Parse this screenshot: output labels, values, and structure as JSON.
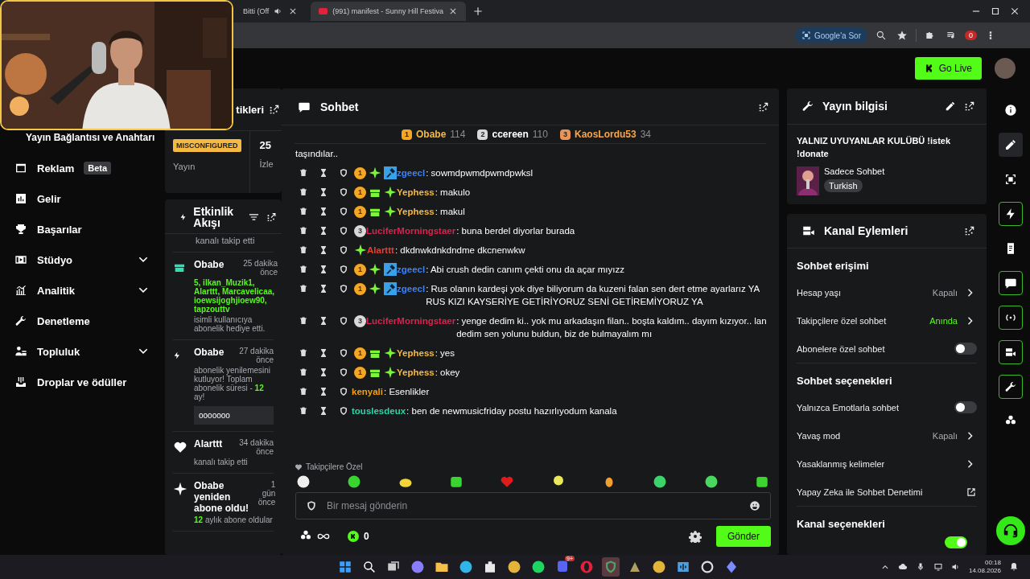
{
  "browser": {
    "tabs": [
      {
        "title": "Bitti (Off",
        "selected": false,
        "audio": true
      },
      {
        "title": "(991) manifest - Sunny Hill Festiva",
        "selected": true,
        "audio": false
      }
    ],
    "ask_google": "Google'a Sor",
    "extension_badge": "0"
  },
  "header": {
    "go_live": "Go Live"
  },
  "nav": [
    {
      "label": "Yayın Bağlantısı ve Anahtarı",
      "kind": "plain"
    },
    {
      "label": "Reklam",
      "kind": "ad",
      "badge": "Beta",
      "expandable": false
    },
    {
      "label": "Gelir",
      "kind": "revenue",
      "expandable": false
    },
    {
      "label": "Başarılar",
      "kind": "trophy",
      "expandable": false
    },
    {
      "label": "Stüdyo",
      "kind": "studio",
      "expandable": true
    },
    {
      "label": "Analitik",
      "kind": "analytics",
      "expandable": true
    },
    {
      "label": "Denetleme",
      "kind": "wrench",
      "expandable": false
    },
    {
      "label": "Topluluk",
      "kind": "community",
      "expandable": true
    },
    {
      "label": "Droplar ve ödüller",
      "kind": "drops",
      "expandable": false
    }
  ],
  "stats_card": {
    "title": "tikleri",
    "status": "MISCONFIGURED",
    "label": "Yayın",
    "value": "25",
    "value_label": "İzle"
  },
  "activity": {
    "title": "Etkinlik Akışı",
    "events": [
      {
        "kind": "tail",
        "text": "kanalı takip etti"
      },
      {
        "kind": "gift",
        "user": "Obabe",
        "time": "25 dakika önce",
        "recipients": "5, ilkan_Muzik1, Alarttt, Marcavelicaa, ioewsijoghjioew90, tapzouttv",
        "text": "isimli kullanıcıya abonelik hediye etti."
      },
      {
        "kind": "renew",
        "user": "Obabe",
        "time": "27 dakika önce",
        "text": "abonelik yenilemesini kutluyor! Toplam abonelik süresi - **12** ay!",
        "message": "ooooooo"
      },
      {
        "kind": "follow",
        "user": "Alarttt",
        "time": "34 dakika önce",
        "text": "kanalı takip etti"
      },
      {
        "kind": "resub",
        "user": "Obabe yeniden abone oldu!",
        "time": "1 gün önce",
        "text": "**12** aylık abone oldular"
      }
    ]
  },
  "chat": {
    "title": "Sohbet",
    "leaders": [
      {
        "rank": "1",
        "name": "Obabe",
        "score": "114"
      },
      {
        "rank": "2",
        "name": "ccereen",
        "score": "110"
      },
      {
        "rank": "3",
        "name": "KaosLordu53",
        "score": "34"
      }
    ],
    "fragment": "taşındılar..",
    "messages": [
      {
        "badges": [
          {
            "kind": "sub",
            "text": "1",
            "color": "#f5a623"
          },
          {
            "kind": "sparkle"
          },
          {
            "kind": "mod"
          }
        ],
        "user": "zgeecl",
        "color": "#3b82f6",
        "text": ": sowmdpwmdpwmdpwksl"
      },
      {
        "badges": [
          {
            "kind": "sub",
            "text": "1",
            "color": "#f5a623"
          },
          {
            "kind": "gift"
          },
          {
            "kind": "sparkle"
          }
        ],
        "user": "Yephess",
        "color": "#f5b942",
        "text": ": makulo"
      },
      {
        "badges": [
          {
            "kind": "sub",
            "text": "1",
            "color": "#f5a623"
          },
          {
            "kind": "gift"
          },
          {
            "kind": "sparkle"
          }
        ],
        "user": "Yephess",
        "color": "#f5b942",
        "text": ": makul"
      },
      {
        "badges": [
          {
            "kind": "sub",
            "text": "3",
            "color": "#d9d9d9"
          }
        ],
        "user": "LuciferMorningstaer",
        "color": "#d6244f",
        "text": ": buna berdel diyorlar burada"
      },
      {
        "badges": [
          {
            "kind": "sparkle"
          }
        ],
        "user": "Alarttt",
        "color": "#ef3b2c",
        "text": ": dkdnwkdnkdndme dkcnenwkw"
      },
      {
        "badges": [
          {
            "kind": "sub",
            "text": "1",
            "color": "#f5a623"
          },
          {
            "kind": "sparkle"
          },
          {
            "kind": "mod"
          }
        ],
        "user": "zgeecl",
        "color": "#3b82f6",
        "text": ": Abi crush dedin canım çekti onu da açar mıyızz"
      },
      {
        "badges": [
          {
            "kind": "sub",
            "text": "1",
            "color": "#f5a623"
          },
          {
            "kind": "sparkle"
          },
          {
            "kind": "mod"
          }
        ],
        "user": "zgeecl",
        "color": "#3b82f6",
        "text": ": Rus olanın kardeşi yok diye biliyorum da kuzeni falan sen dert etme ayarlarız YA RUS KIZI KAYSERİYE GETİRİYORUZ SENİ GETİREMİYORUZ YA"
      },
      {
        "badges": [
          {
            "kind": "sub",
            "text": "3",
            "color": "#d9d9d9"
          }
        ],
        "user": "LuciferMorningstaer",
        "color": "#d6244f",
        "text": ": yenge dedim ki.. yok mu arkadaşın filan.. boşta kaldım.. dayım kızıyor.. lan dedim sen yolunu buldun, biz de bulmayalım mı"
      },
      {
        "badges": [
          {
            "kind": "sub",
            "text": "1",
            "color": "#f5a623"
          },
          {
            "kind": "gift"
          },
          {
            "kind": "sparkle"
          }
        ],
        "user": "Yephess",
        "color": "#f5b942",
        "text": ": yes"
      },
      {
        "badges": [
          {
            "kind": "sub",
            "text": "1",
            "color": "#f5a623"
          },
          {
            "kind": "gift"
          },
          {
            "kind": "sparkle"
          }
        ],
        "user": "Yephess",
        "color": "#f5b942",
        "text": ": okey"
      },
      {
        "user": "kenyali",
        "color": "#f59e0b",
        "text": ": Esenlikler"
      },
      {
        "user": "touslesdeux",
        "color": "#2dd4a8",
        "text": ": ben de newmusicfriday postu hazırlıyodum kanala"
      }
    ],
    "followers_only": "Takipçilere Özel",
    "emotes": [
      {
        "kind": "cool"
      },
      {
        "kind": "blob"
      },
      {
        "kind": "bee"
      },
      {
        "kind": "halo"
      },
      {
        "kind": "heart"
      },
      {
        "kind": "dj"
      },
      {
        "kind": "crest"
      },
      {
        "kind": "headphones"
      },
      {
        "kind": "party"
      },
      {
        "kind": "angry"
      }
    ],
    "placeholder": "Bir mesaj gönderin",
    "points": "0",
    "send": "Gönder"
  },
  "stream_info": {
    "title": "Yayın bilgisi",
    "stream_title": "YALNIZ UYUYANLAR KULÜBÜ !istek !donate",
    "category": "Sadece Sohbet",
    "tag": "Turkish"
  },
  "channel_actions": {
    "title": "Kanal Eylemleri",
    "sections": [
      {
        "heading": "Sohbet erişimi",
        "rows": [
          {
            "kind": "link",
            "label": "Hesap yaşı",
            "value": "Kapalı",
            "highlight": false
          },
          {
            "kind": "link",
            "label": "Takipçilere özel sohbet",
            "value": "Anında",
            "highlight": true
          },
          {
            "kind": "toggle",
            "label": "Abonelere özel sohbet",
            "on": false
          }
        ]
      },
      {
        "heading": "Sohbet seçenekleri",
        "rows": [
          {
            "kind": "toggle",
            "label": "Yalnızca Emotlarla sohbet",
            "on": false
          },
          {
            "kind": "link",
            "label": "Yavaş mod",
            "value": "Kapalı",
            "highlight": false
          },
          {
            "kind": "link",
            "label": "Yasaklanmış kelimeler"
          },
          {
            "kind": "external",
            "label": "Yapay Zeka ile Sohbet Denetimi"
          }
        ]
      },
      {
        "heading": "Kanal seçenekleri",
        "rows": [
          {
            "kind": "toggle",
            "on": true
          }
        ]
      }
    ]
  },
  "rail": [
    {
      "kind": "info",
      "selected": false,
      "pinned": false
    },
    {
      "kind": "pencil",
      "selected": true,
      "pinned": false
    },
    {
      "kind": "capture",
      "selected": false,
      "pinned": false
    },
    {
      "kind": "bolt",
      "selected": false,
      "pinned": true
    },
    {
      "kind": "note",
      "selected": false,
      "pinned": false
    },
    {
      "kind": "chat",
      "selected": false,
      "pinned": true
    },
    {
      "kind": "broadcast",
      "selected": false,
      "pinned": true
    },
    {
      "kind": "camera",
      "selected": false,
      "pinned": true
    },
    {
      "kind": "wrench",
      "selected": false,
      "pinned": true
    },
    {
      "kind": "dots",
      "selected": false,
      "pinned": false
    }
  ],
  "taskbar": {
    "apps": [
      {
        "kind": "start",
        "selected": false
      },
      {
        "kind": "search",
        "selected": false
      },
      {
        "kind": "taskview",
        "selected": false
      },
      {
        "kind": "copilot",
        "selected": false
      },
      {
        "kind": "files",
        "selected": false
      },
      {
        "kind": "edge",
        "selected": false
      },
      {
        "kind": "store",
        "selected": false
      },
      {
        "kind": "chrome",
        "selected": false
      },
      {
        "kind": "spotify",
        "selected": false
      },
      {
        "kind": "discord",
        "selected": false,
        "badge": "9+"
      },
      {
        "kind": "opera",
        "selected": false
      },
      {
        "kind": "shield",
        "selected": true
      },
      {
        "kind": "game",
        "selected": false
      },
      {
        "kind": "chrome",
        "selected": false
      },
      {
        "kind": "audio",
        "selected": false
      },
      {
        "kind": "obs",
        "selected": false
      },
      {
        "kind": "diamond",
        "selected": false
      }
    ],
    "time": "00:18",
    "date": "14.08.2026"
  }
}
